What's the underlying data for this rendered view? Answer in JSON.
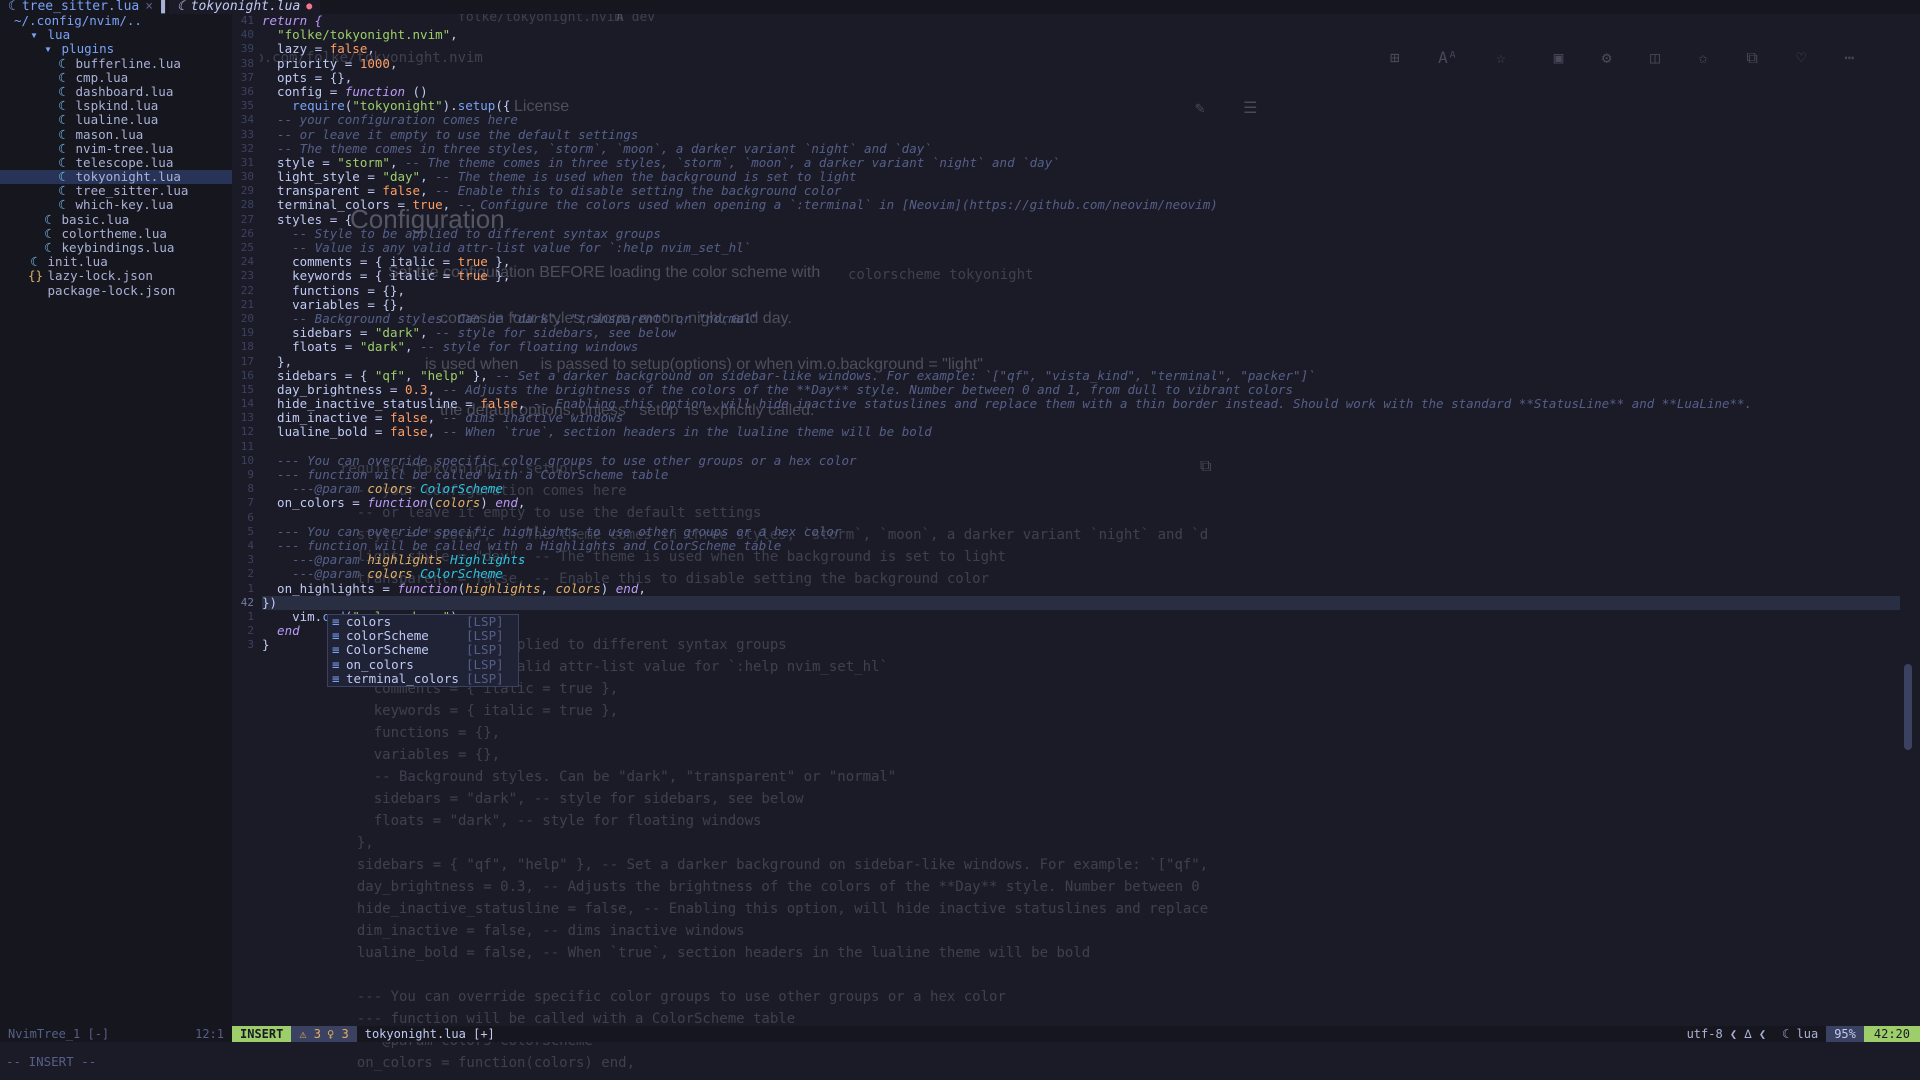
{
  "tabs": [
    {
      "label": "tree_sitter.lua",
      "close": "×"
    },
    {
      "label": "tokyonight.lua",
      "modified": "●"
    }
  ],
  "tree": {
    "root": "~/.config/nvim/..",
    "rows": [
      {
        "icon": "▾",
        "label": "lua",
        "indent": 1,
        "type": "dir"
      },
      {
        "icon": "▾",
        "label": "plugins",
        "indent": 2,
        "type": "dir"
      },
      {
        "icon": "☾",
        "label": "bufferline.lua",
        "indent": 3,
        "type": "file"
      },
      {
        "icon": "☾",
        "label": "cmp.lua",
        "indent": 3,
        "type": "file"
      },
      {
        "icon": "☾",
        "label": "dashboard.lua",
        "indent": 3,
        "type": "file"
      },
      {
        "icon": "☾",
        "label": "lspkind.lua",
        "indent": 3,
        "type": "file"
      },
      {
        "icon": "☾",
        "label": "lualine.lua",
        "indent": 3,
        "type": "file"
      },
      {
        "icon": "☾",
        "label": "mason.lua",
        "indent": 3,
        "type": "file"
      },
      {
        "icon": "☾",
        "label": "nvim-tree.lua",
        "indent": 3,
        "type": "file"
      },
      {
        "icon": "☾",
        "label": "telescope.lua",
        "indent": 3,
        "type": "file"
      },
      {
        "icon": "☾",
        "label": "tokyonight.lua",
        "indent": 3,
        "type": "file",
        "selected": true
      },
      {
        "icon": "☾",
        "label": "tree_sitter.lua",
        "indent": 3,
        "type": "file"
      },
      {
        "icon": "☾",
        "label": "which-key.lua",
        "indent": 3,
        "type": "file"
      },
      {
        "icon": "☾",
        "label": "basic.lua",
        "indent": 2,
        "type": "file"
      },
      {
        "icon": "☾",
        "label": "colortheme.lua",
        "indent": 2,
        "type": "file"
      },
      {
        "icon": "☾",
        "label": "keybindings.lua",
        "indent": 2,
        "type": "file"
      },
      {
        "icon": "☾",
        "label": "init.lua",
        "indent": 1,
        "type": "file"
      },
      {
        "icon": "{}",
        "label": "lazy-lock.json",
        "indent": 1,
        "type": "json"
      },
      {
        "icon": "",
        "label": "package-lock.json",
        "indent": 1,
        "type": "json"
      }
    ]
  },
  "code": {
    "current_line_index": 41,
    "lines": [
      [
        {
          "t": "return {",
          "c": "kw"
        }
      ],
      [
        {
          "t": "  "
        },
        {
          "t": "\"folke/tokyonight.nvim\"",
          "c": "str"
        },
        {
          "t": ","
        }
      ],
      [
        {
          "t": "  lazy = "
        },
        {
          "t": "false",
          "c": "bool"
        },
        {
          "t": ","
        }
      ],
      [
        {
          "t": "  priority = "
        },
        {
          "t": "1000",
          "c": "num"
        },
        {
          "t": ","
        }
      ],
      [
        {
          "t": "  opts = {},"
        }
      ],
      [
        {
          "t": "  config = "
        },
        {
          "t": "function",
          "c": "kw"
        },
        {
          "t": " ()"
        }
      ],
      [
        {
          "t": "    "
        },
        {
          "t": "require",
          "c": "fn"
        },
        {
          "t": "("
        },
        {
          "t": "\"tokyonight\"",
          "c": "str"
        },
        {
          "t": ")."
        },
        {
          "t": "setup",
          "c": "fn"
        },
        {
          "t": "({"
        }
      ],
      [
        {
          "t": "  -- your configuration comes here",
          "c": "cm"
        }
      ],
      [
        {
          "t": "  -- or leave it empty to use the default settings",
          "c": "cm"
        }
      ],
      [
        {
          "t": "  -- The theme comes in three styles, `storm`, `moon`, a darker variant `night` and `day`",
          "c": "cm"
        }
      ],
      [
        {
          "t": "  style = "
        },
        {
          "t": "\"storm\"",
          "c": "str"
        },
        {
          "t": ", "
        },
        {
          "t": "-- The theme comes in three styles, `storm`, `moon`, a darker variant `night` and `day`",
          "c": "cm"
        }
      ],
      [
        {
          "t": "  light_style = "
        },
        {
          "t": "\"day\"",
          "c": "str"
        },
        {
          "t": ", "
        },
        {
          "t": "-- The theme is used when the background is set to light",
          "c": "cm"
        }
      ],
      [
        {
          "t": "  transparent = "
        },
        {
          "t": "false",
          "c": "bool"
        },
        {
          "t": ", "
        },
        {
          "t": "-- Enable this to disable setting the background color",
          "c": "cm"
        }
      ],
      [
        {
          "t": "  terminal_colors = "
        },
        {
          "t": "true",
          "c": "bool"
        },
        {
          "t": ", "
        },
        {
          "t": "-- Configure the colors used when opening a `:terminal` in [Neovim](https://github.com/neovim/neovim)",
          "c": "cm"
        }
      ],
      [
        {
          "t": "  styles = {"
        }
      ],
      [
        {
          "t": "    -- Style to be applied to different syntax groups",
          "c": "cm"
        }
      ],
      [
        {
          "t": "    -- Value is any valid attr-list value for `:help nvim_set_hl`",
          "c": "cm"
        }
      ],
      [
        {
          "t": "    comments = { italic = "
        },
        {
          "t": "true",
          "c": "bool"
        },
        {
          "t": " },"
        }
      ],
      [
        {
          "t": "    keywords = { italic = "
        },
        {
          "t": "true",
          "c": "bool"
        },
        {
          "t": " },"
        }
      ],
      [
        {
          "t": "    functions = {},"
        }
      ],
      [
        {
          "t": "    variables = {},"
        }
      ],
      [
        {
          "t": "    -- Background styles. Can be \"dark\", \"transparent\" or \"normal\"",
          "c": "cm"
        }
      ],
      [
        {
          "t": "    sidebars = "
        },
        {
          "t": "\"dark\"",
          "c": "str"
        },
        {
          "t": ", "
        },
        {
          "t": "-- style for sidebars, see below",
          "c": "cm"
        }
      ],
      [
        {
          "t": "    floats = "
        },
        {
          "t": "\"dark\"",
          "c": "str"
        },
        {
          "t": ", "
        },
        {
          "t": "-- style for floating windows",
          "c": "cm"
        }
      ],
      [
        {
          "t": "  },"
        }
      ],
      [
        {
          "t": "  sidebars = { "
        },
        {
          "t": "\"qf\"",
          "c": "str"
        },
        {
          "t": ", "
        },
        {
          "t": "\"help\"",
          "c": "str"
        },
        {
          "t": " }, "
        },
        {
          "t": "-- Set a darker background on sidebar-like windows. For example: `[\"qf\", \"vista_kind\", \"terminal\", \"packer\"]`",
          "c": "cm"
        }
      ],
      [
        {
          "t": "  day_brightness = "
        },
        {
          "t": "0.3",
          "c": "num"
        },
        {
          "t": ", "
        },
        {
          "t": "-- Adjusts the brightness of the colors of the **Day** style. Number between 0 and 1, from dull to vibrant colors",
          "c": "cm"
        }
      ],
      [
        {
          "t": "  hide_inactive_statusline = "
        },
        {
          "t": "false",
          "c": "bool"
        },
        {
          "t": ", "
        },
        {
          "t": "-- Enabling this option, will hide inactive statuslines and replace them with a thin border instead. Should work with the standard **StatusLine** and **LuaLine**.",
          "c": "cm"
        }
      ],
      [
        {
          "t": "  dim_inactive = "
        },
        {
          "t": "false",
          "c": "bool"
        },
        {
          "t": ", "
        },
        {
          "t": "-- dims inactive windows",
          "c": "cm"
        }
      ],
      [
        {
          "t": "  lualine_bold = "
        },
        {
          "t": "false",
          "c": "bool"
        },
        {
          "t": ", "
        },
        {
          "t": "-- When `true`, section headers in the lualine theme will be bold",
          "c": "cm"
        }
      ],
      [
        {
          "t": ""
        }
      ],
      [
        {
          "t": "  --- You can override specific color groups to use other groups or a hex color",
          "c": "cm"
        }
      ],
      [
        {
          "t": "  --- function will be called with a ColorScheme table",
          "c": "cm"
        }
      ],
      [
        {
          "t": "    "
        },
        {
          "t": "---@param",
          "c": "cm"
        },
        {
          "t": " "
        },
        {
          "t": "colors",
          "c": "prm"
        },
        {
          "t": " "
        },
        {
          "t": "ColorScheme",
          "c": "typ"
        }
      ],
      [
        {
          "t": "  on_colors = "
        },
        {
          "t": "function",
          "c": "kw"
        },
        {
          "t": "("
        },
        {
          "t": "colors",
          "c": "prm"
        },
        {
          "t": ") "
        },
        {
          "t": "end",
          "c": "kw"
        },
        {
          "t": ","
        }
      ],
      [
        {
          "t": ""
        }
      ],
      [
        {
          "t": "  --- You can override specific highlights to use other groups or a hex color",
          "c": "cm"
        }
      ],
      [
        {
          "t": "  --- function will be called with a Highlights and ColorScheme table",
          "c": "cm"
        }
      ],
      [
        {
          "t": "    "
        },
        {
          "t": "---@param",
          "c": "cm"
        },
        {
          "t": " "
        },
        {
          "t": "highlights",
          "c": "prm"
        },
        {
          "t": " "
        },
        {
          "t": "Highlights",
          "c": "typ"
        }
      ],
      [
        {
          "t": "    "
        },
        {
          "t": "---@param",
          "c": "cm"
        },
        {
          "t": " "
        },
        {
          "t": "colors",
          "c": "prm"
        },
        {
          "t": " "
        },
        {
          "t": "ColorScheme",
          "c": "typ"
        }
      ],
      [
        {
          "t": "  on_highlights = "
        },
        {
          "t": "function",
          "c": "kw"
        },
        {
          "t": "("
        },
        {
          "t": "highlights",
          "c": "prm"
        },
        {
          "t": ", "
        },
        {
          "t": "colors",
          "c": "prm"
        },
        {
          "t": ") "
        },
        {
          "t": "end",
          "c": "kw"
        },
        {
          "t": ","
        }
      ],
      [
        {
          "t": "})"
        }
      ],
      [
        {
          "t": "    vim."
        },
        {
          "t": "cmd",
          "c": "fn"
        },
        {
          "t": "("
        },
        {
          "t": "\"colorscheme\"",
          "c": "str"
        },
        {
          "t": ")"
        }
      ],
      [
        {
          "t": "  end",
          "c": "kw"
        }
      ],
      [
        {
          "t": "}"
        }
      ]
    ]
  },
  "completion": {
    "items": [
      {
        "kind": "≡",
        "word": "colors",
        "source": "[LSP]"
      },
      {
        "kind": "≡",
        "word": "colorScheme",
        "source": "[LSP]"
      },
      {
        "kind": "≡",
        "word": "ColorScheme",
        "source": "[LSP]"
      },
      {
        "kind": "≡",
        "word": "on_colors",
        "source": "[LSP]"
      },
      {
        "kind": "≡",
        "word": "terminal_colors",
        "source": "[LSP]"
      }
    ]
  },
  "ghost": {
    "browser_tab": "folke/tokyonight.nvim",
    "browser_tab2": "A dev",
    "url": "thub.com/folke/tokyonight.nvim",
    "license": "License",
    "setup_call": "require(\"tokyonight\").setup({",
    "colorscheme_call": "vim.cmd[[colorscheme tokyonight]]",
    "heading": "Configuration",
    "para1": "Set the configuration BEFORE loading the color scheme with",
    "para1_code": "colorscheme tokyonight",
    "para2": "comes in four styles, storm, moon, night, and day.",
    "para3": "is used when     is passed to setup(options) or when vim.o.background = \"light\"",
    "para4": "the default options, unless   setup  is explicitly called.",
    "ghost_code": [
      "require(\"tokyonight\").setup({",
      "  -- your configuration comes here",
      "  -- or leave it empty to use the default settings",
      "  style = \"storm\", -- The theme comes in three styles, `storm`, `moon`, a darker variant `night` and `d",
      "  light_style = \"day\", -- The theme is used when the background is set to light",
      "  transparent = false, -- Enable this to disable setting the background color",
      "",
      "  styles = {",
      "    -- Style to be applied to different syntax groups",
      "    -- Value is any valid attr-list value for `:help nvim_set_hl`",
      "    comments = { italic = true },",
      "    keywords = { italic = true },",
      "    functions = {},",
      "    variables = {},",
      "    -- Background styles. Can be \"dark\", \"transparent\" or \"normal\"",
      "    sidebars = \"dark\", -- style for sidebars, see below",
      "    floats = \"dark\", -- style for floating windows",
      "  },",
      "  sidebars = { \"qf\", \"help\" }, -- Set a darker background on sidebar-like windows. For example: `[\"qf\",",
      "  day_brightness = 0.3, -- Adjusts the brightness of the colors of the **Day** style. Number between 0",
      "  hide_inactive_statusline = false, -- Enabling this option, will hide inactive statuslines and replace",
      "  dim_inactive = false, -- dims inactive windows",
      "  lualine_bold = false, -- When `true`, section headers in the lualine theme will be bold",
      "",
      "  --- You can override specific color groups to use other groups or a hex color",
      "  --- function will be called with a ColorScheme table",
      "  ---@param colors ColorScheme",
      "  on_colors = function(colors) end,"
    ]
  },
  "status": {
    "tree_name": "NvimTree_1 [-]",
    "tree_pos": "12:1",
    "mode": "INSERT",
    "diag_warn": "⚠ 3",
    "diag_hint": "♀ 3",
    "file": "tokyonight.lua [+]",
    "encoding": "utf-8 ❮ ∆ ❮",
    "filetype": "☾ lua",
    "percent": "95%",
    "position": "42:20"
  },
  "cmdline": "-- INSERT --",
  "colors": {
    "bg": "#1a1b26",
    "accent": "#7aa2f7",
    "mode_green": "#9ece6a"
  }
}
